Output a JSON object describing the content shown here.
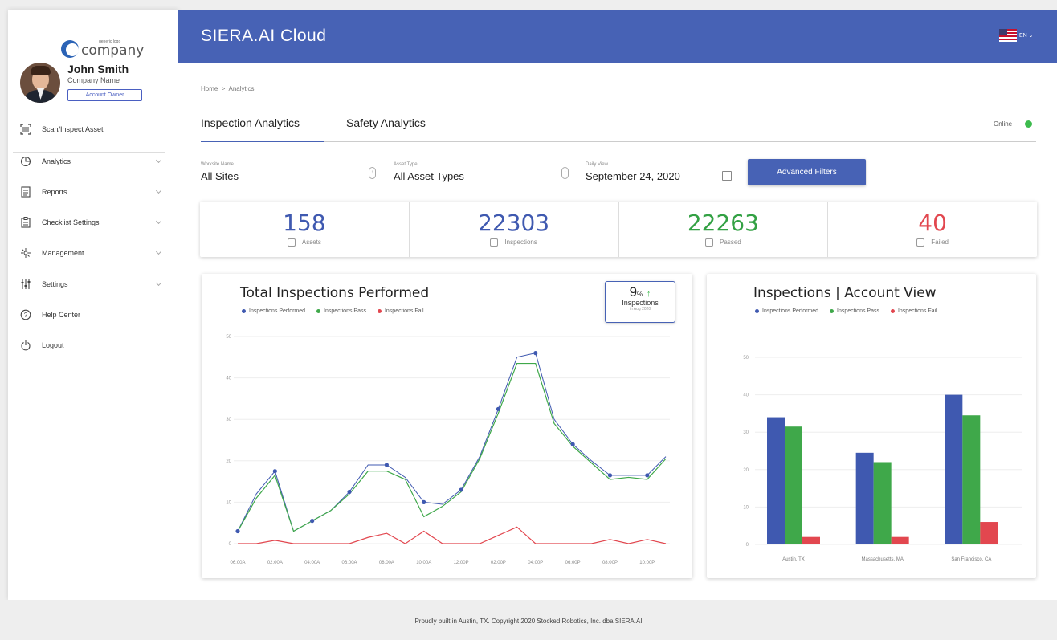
{
  "sidebar": {
    "logo_small": "generic logo",
    "logo_big": "company",
    "user_name": "John Smith",
    "user_company": "Company Name",
    "role": "Account Owner",
    "nav": [
      {
        "label": "Scan/Inspect Asset",
        "icon": "scan-icon"
      },
      {
        "label": "Analytics",
        "icon": "pie-chart-icon"
      },
      {
        "label": "Reports",
        "icon": "report-icon"
      },
      {
        "label": "Checklist Settings",
        "icon": "checklist-icon"
      },
      {
        "label": "Management",
        "icon": "management-icon"
      },
      {
        "label": "Settings",
        "icon": "sliders-icon"
      },
      {
        "label": "Help Center",
        "icon": "help-icon"
      },
      {
        "label": "Logout",
        "icon": "power-icon"
      }
    ]
  },
  "header": {
    "brand": "SIERA.AI Cloud",
    "lang": "EN",
    "flag_icon": "us-flag-icon"
  },
  "breadcrumb": {
    "home": "Home",
    "sep": ">",
    "current": "Analytics"
  },
  "tabs": [
    "Inspection Analytics",
    "Safety Analytics"
  ],
  "status": {
    "label": "Online",
    "color": "#3dbb4d"
  },
  "filters": {
    "site": {
      "label": "Worksite Name",
      "value": "All Sites"
    },
    "asset": {
      "label": "Asset Type",
      "value": "All Asset Types"
    },
    "date": {
      "label": "Daily View",
      "value": "September 24, 2020"
    },
    "advanced": "Advanced Filters"
  },
  "stats": [
    {
      "value": "158",
      "label": "Assets",
      "color": "#3f59b0"
    },
    {
      "value": "22303",
      "label": "Inspections",
      "color": "#3f59b0"
    },
    {
      "value": "22263",
      "label": "Passed",
      "color": "#33a144"
    },
    {
      "value": "40",
      "label": "Failed",
      "color": "#e2474f"
    }
  ],
  "line_card": {
    "title": "Total Inspections Performed",
    "kpi_value": "9",
    "kpi_unit": "%",
    "kpi_arrow": "↑",
    "kpi_label": "Inspections",
    "kpi_sub": "in Aug 2020"
  },
  "bar_card": {
    "title": "Inspections | Account View"
  },
  "colors": {
    "performed": "#3f59b0",
    "pass": "#3fa84a",
    "fail": "#e2474f",
    "accent": "#4762b5"
  },
  "chart_data": [
    {
      "type": "line",
      "title": "Total Inspections Performed",
      "x": [
        "06:00A",
        "",
        "02:00A",
        "",
        "04:00A",
        "",
        "06:00A",
        "",
        "08:00A",
        "",
        "10:00A",
        "",
        "12:00P",
        "",
        "02:00P",
        "",
        "04:00P",
        "",
        "06:00P",
        "",
        "08:00P",
        "",
        "10:00P",
        ""
      ],
      "x_tick_labels": [
        "06:00A",
        "02:00A",
        "04:00A",
        "06:00A",
        "08:00A",
        "10:00A",
        "12:00P",
        "02:00P",
        "04:00P",
        "06:00P",
        "08:00P",
        "10:00P"
      ],
      "ylim": [
        0,
        50
      ],
      "y_ticks": [
        0,
        10,
        20,
        30,
        40,
        50
      ],
      "series": [
        {
          "name": "Inspections Performed",
          "values": [
            3,
            12,
            17.5,
            3,
            5.5,
            8,
            12.5,
            19,
            19,
            16,
            10,
            9.5,
            13,
            21,
            32.5,
            45,
            46,
            30,
            24,
            20,
            16.5,
            16.5,
            16.5,
            21
          ]
        },
        {
          "name": "Inspections Pass",
          "values": [
            3,
            11,
            16.5,
            3,
            5.5,
            8,
            12,
            17.5,
            17.5,
            15.5,
            6.5,
            9,
            12.5,
            20.5,
            31.5,
            43.5,
            43.5,
            29,
            23.5,
            19.5,
            15.5,
            16,
            15.5,
            20.5
          ]
        },
        {
          "name": "Inspections Fail",
          "values": [
            0,
            0,
            0.8,
            0,
            0,
            0,
            0,
            1.5,
            2.5,
            0,
            3,
            0,
            0,
            0,
            2,
            4,
            0,
            0,
            0,
            0,
            1,
            0,
            1,
            0
          ]
        }
      ],
      "grid": true,
      "legend": "top-left"
    },
    {
      "type": "bar",
      "title": "Inspections | Account View",
      "categories": [
        "Austin, TX",
        "Massachusetts, MA",
        "San Francisco, CA"
      ],
      "ylim": [
        0,
        50
      ],
      "y_ticks": [
        0,
        10,
        20,
        30,
        40,
        50
      ],
      "series": [
        {
          "name": "Inspections Performed",
          "values": [
            34,
            24.5,
            40
          ]
        },
        {
          "name": "Inspections Pass",
          "values": [
            31.5,
            22,
            34.5
          ]
        },
        {
          "name": "Inspections Fail",
          "values": [
            2,
            2,
            6
          ]
        }
      ],
      "grid": true,
      "legend": "top-left"
    }
  ],
  "footer": "Proudly built in Austin, TX. Copyright 2020 Stocked Robotics, Inc. dba SIERA.AI"
}
